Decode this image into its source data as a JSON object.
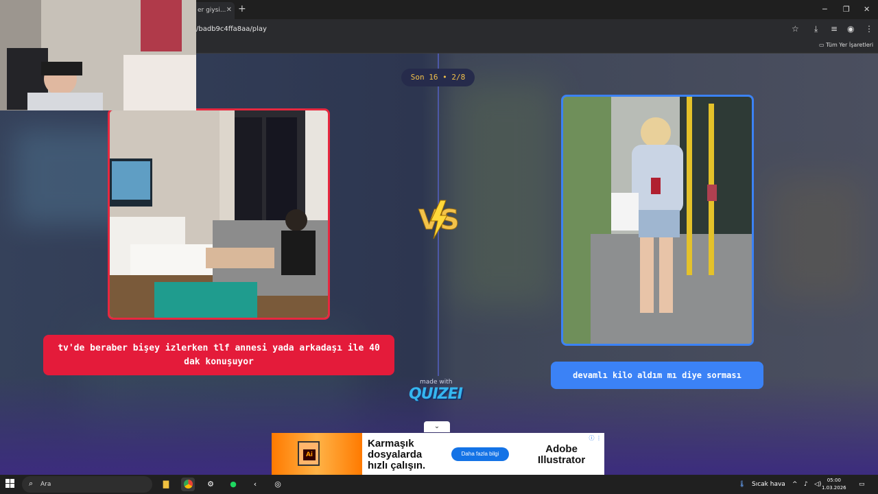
{
  "browser": {
    "tab_title": "er giysi...",
    "url": "/badb9c4ffa8aa/play",
    "bookmarks_all_label": "Tüm Yer İşaretleri"
  },
  "quiz": {
    "counter": "Son 16 • 2/8",
    "left_answer": "tv'de beraber bişey izlerken tlf annesi yada arkadaşı ile 40 dak konuşuyor",
    "right_answer": "devamlı kilo aldım mı diye sorması",
    "vs_label": "VS",
    "made_with": "made with",
    "brand": "QUIZEI"
  },
  "ad": {
    "headline_1": "Karmaşık",
    "headline_2": "dosyalarda",
    "headline_3": "hızlı çalışın.",
    "button": "Daha fazla bilgi",
    "brand_1": "Adobe",
    "brand_2": "Illustrator",
    "product_icon": "Ai"
  },
  "taskbar": {
    "search_placeholder": "Ara",
    "weather": "Sıcak hava",
    "time": "05:00",
    "date": "1.03.2026"
  },
  "colors": {
    "red_accent": "#e41b3a",
    "blue_accent": "#3b82f6",
    "counter_text": "#f3c24a"
  }
}
